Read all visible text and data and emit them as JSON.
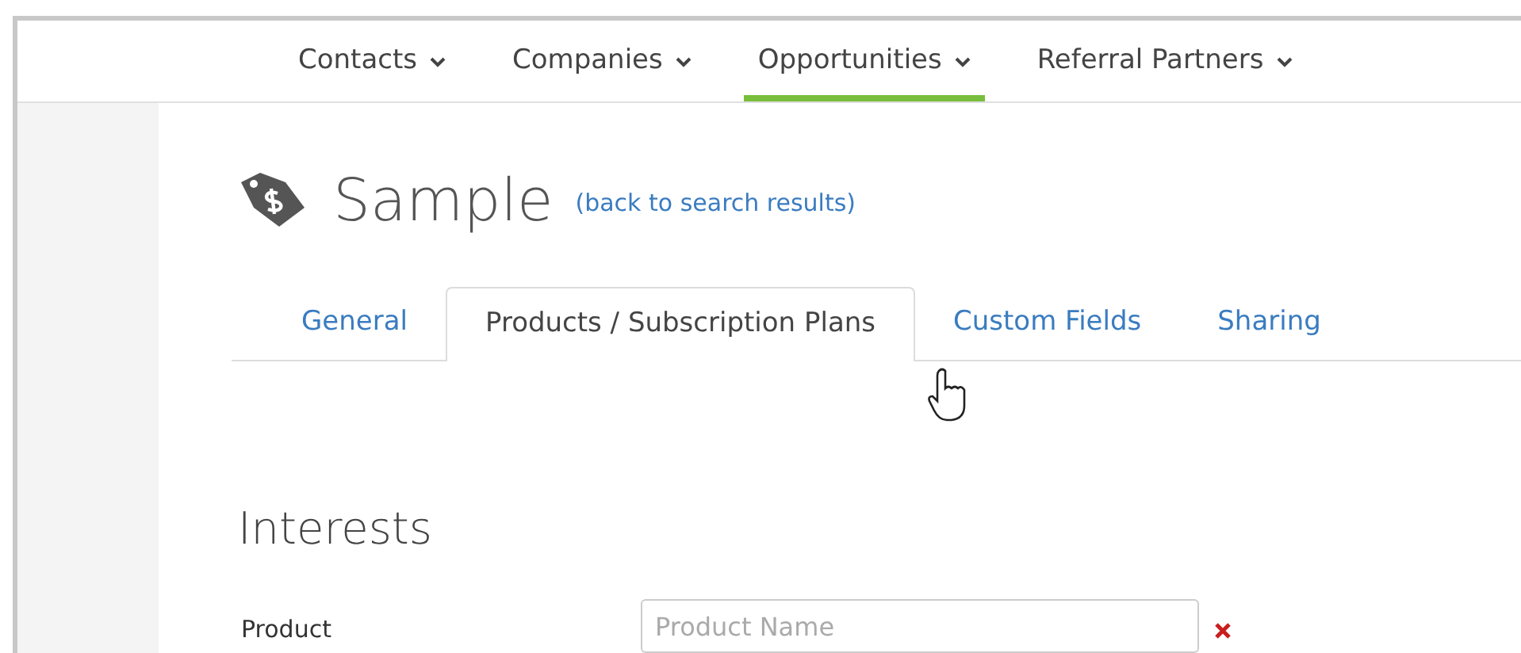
{
  "nav": [
    {
      "label": "Contacts",
      "selected": false
    },
    {
      "label": "Companies",
      "selected": false
    },
    {
      "label": "Opportunities",
      "selected": true
    },
    {
      "label": "Referral Partners",
      "selected": false
    }
  ],
  "header": {
    "title": "Sample",
    "back_link": "(back to search results)"
  },
  "tabs": [
    {
      "label": "General",
      "selected": false
    },
    {
      "label": "Products / Subscription Plans",
      "selected": true
    },
    {
      "label": "Custom Fields",
      "selected": false
    },
    {
      "label": "Sharing",
      "selected": false
    }
  ],
  "section": {
    "title": "Interests"
  },
  "fields": [
    {
      "label": "Product",
      "placeholder": "Product Name"
    }
  ]
}
